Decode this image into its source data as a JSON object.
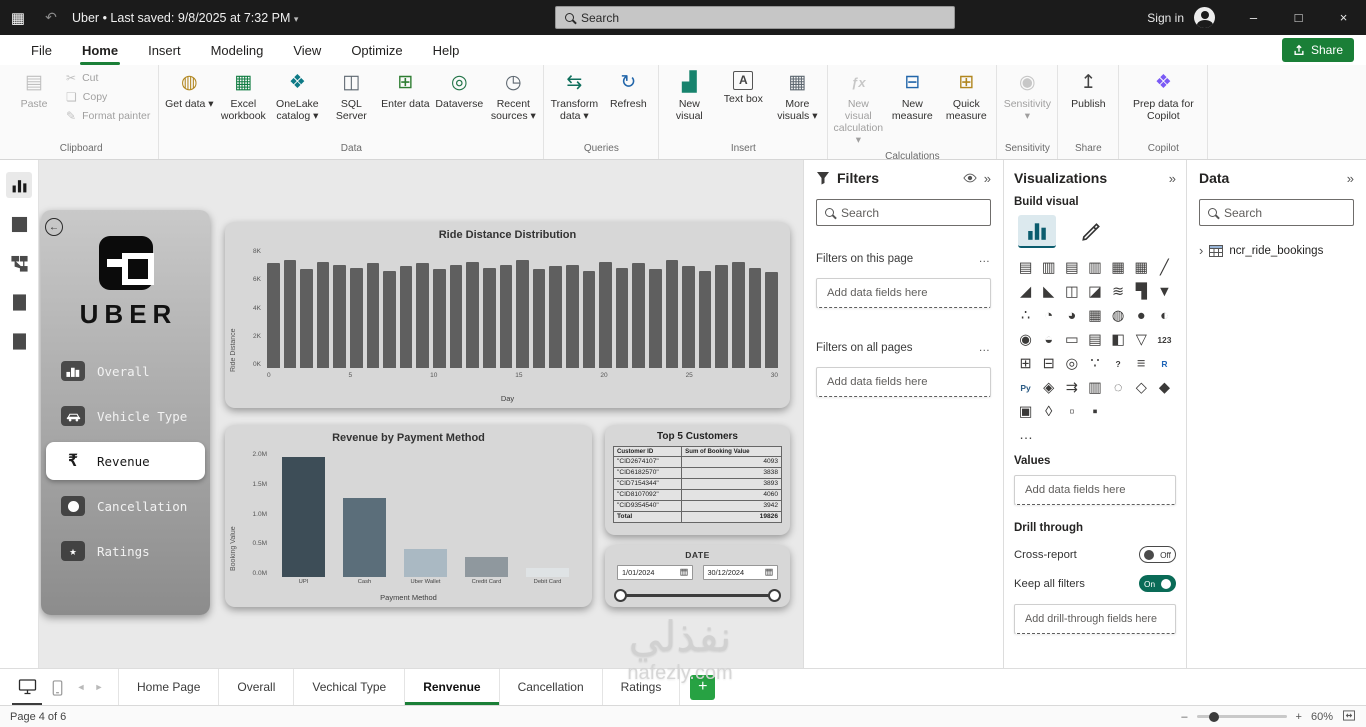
{
  "titlebar": {
    "app_icon_glyph": "▦",
    "undo_glyph": "↶",
    "title": "Uber • Last saved: 9/8/2025 at 7:32 PM",
    "title_caret": "▾",
    "search_placeholder": "Search",
    "sign_in": "Sign in",
    "minimize_glyph": "–",
    "maximize_glyph": "□",
    "close_glyph": "×"
  },
  "menu": {
    "items": [
      "File",
      "Home",
      "Insert",
      "Modeling",
      "View",
      "Optimize",
      "Help"
    ],
    "active_index": 1,
    "share_label": "Share"
  },
  "ribbon": {
    "caret": "▾",
    "groups": [
      {
        "label": "Clipboard",
        "items": [
          {
            "label": "Paste",
            "glyph": "▤",
            "color": "#7a7a7a",
            "disabled": true
          },
          {
            "label": "Cut",
            "glyph": "✂",
            "color": "#7a7a7a",
            "disabled": true,
            "small": true
          },
          {
            "label": "Copy",
            "glyph": "❏",
            "color": "#7a7a7a",
            "disabled": true,
            "small": true
          },
          {
            "label": "Format painter",
            "glyph": "✎",
            "color": "#7a7a7a",
            "disabled": true,
            "small": true
          }
        ]
      },
      {
        "label": "Data",
        "items": [
          {
            "label": "Get data",
            "glyph": "◍",
            "color": "#b1861f",
            "dropdown": true
          },
          {
            "label": "Excel workbook",
            "glyph": "▦",
            "color": "#107c41"
          },
          {
            "label": "OneLake catalog",
            "glyph": "❖",
            "color": "#0e7a86",
            "dropdown": true
          },
          {
            "label": "SQL Server",
            "glyph": "◫",
            "color": "#5d6770"
          },
          {
            "label": "Enter data",
            "glyph": "⊞",
            "color": "#2e7d32"
          },
          {
            "label": "Dataverse",
            "glyph": "◎",
            "color": "#217346"
          },
          {
            "label": "Recent sources",
            "glyph": "◷",
            "color": "#5d6770",
            "dropdown": true
          }
        ]
      },
      {
        "label": "Queries",
        "items": [
          {
            "label": "Transform data",
            "glyph": "⇆",
            "color": "#0f6f5c",
            "dropdown": true
          },
          {
            "label": "Refresh",
            "glyph": "↻",
            "color": "#2266aa"
          }
        ]
      },
      {
        "label": "Insert",
        "items": [
          {
            "label": "New visual",
            "glyph": "▟",
            "color": "#17836d"
          },
          {
            "label": "Text box",
            "glyph": "A",
            "color": "#444444",
            "boxed": true
          },
          {
            "label": "More visuals",
            "glyph": "▦",
            "color": "#5d6770",
            "dropdown": true
          }
        ]
      },
      {
        "label": "Calculations",
        "items": [
          {
            "label": "New visual calculation",
            "glyph": "ƒx",
            "color": "#8a8a8a",
            "disabled": true,
            "text_icon": true,
            "dropdown": true
          },
          {
            "label": "New measure",
            "glyph": "⊟",
            "color": "#2266aa"
          },
          {
            "label": "Quick measure",
            "glyph": "⊞",
            "color": "#b1861f"
          }
        ]
      },
      {
        "label": "Sensitivity",
        "items": [
          {
            "label": "Sensitivity",
            "glyph": "◉",
            "color": "#8a8a8a",
            "disabled": true,
            "dropdown": true
          }
        ]
      },
      {
        "label": "Share",
        "items": [
          {
            "label": "Publish",
            "glyph": "↥",
            "color": "#444444"
          }
        ]
      },
      {
        "label": "Copilot",
        "items": [
          {
            "label": "Prep data for Copilot",
            "glyph": "❖",
            "color": "#7a5af5",
            "wide": true
          }
        ]
      }
    ]
  },
  "view_rail": {
    "items": [
      {
        "name": "report-view",
        "active": true
      },
      {
        "name": "table-view"
      },
      {
        "name": "model-view"
      },
      {
        "name": "dax-query-view"
      },
      {
        "name": "tmdl-view"
      }
    ]
  },
  "dashboard": {
    "back_glyph": "←",
    "sidebar": {
      "brand": "UBER",
      "nav": [
        {
          "label": "Overall",
          "icon": "bar-chart-icon"
        },
        {
          "label": "Vehicle Type",
          "icon": "car-icon"
        },
        {
          "label": "Revenue",
          "icon": "rupee-icon",
          "active": true
        },
        {
          "label": "Cancellation",
          "icon": "cancel-icon"
        },
        {
          "label": "Ratings",
          "icon": "star-icon"
        }
      ]
    }
  },
  "chart_data": [
    {
      "type": "bar",
      "title": "Ride Distance Distribution",
      "xlabel": "Day",
      "ylabel": "Ride Distance",
      "x": [
        0,
        1,
        2,
        3,
        4,
        5,
        6,
        7,
        8,
        9,
        10,
        11,
        12,
        13,
        14,
        15,
        16,
        17,
        18,
        19,
        20,
        21,
        22,
        23,
        24,
        25,
        26,
        27,
        28,
        29,
        30
      ],
      "values": [
        7000,
        7200,
        6600,
        7100,
        6900,
        6700,
        7000,
        6500,
        6800,
        7000,
        6600,
        6900,
        7100,
        6700,
        6900,
        7200,
        6600,
        6800,
        6900,
        6500,
        7100,
        6700,
        7000,
        6600,
        7200,
        6800,
        6500,
        6900,
        7100,
        6700,
        6400
      ],
      "ylim": [
        0,
        8000
      ],
      "ytick_labels": [
        "0K",
        "2K",
        "4K",
        "6K",
        "8K"
      ],
      "xtick_labels": [
        "0",
        "5",
        "10",
        "15",
        "20",
        "25",
        "30"
      ],
      "bar_color": "#5f5f5f"
    },
    {
      "type": "bar",
      "title": "Revenue by Payment Method",
      "xlabel": "Payment Method",
      "ylabel": "Booking Value",
      "categories": [
        "UPI",
        "Cash",
        "Uber Wallet",
        "Credit Card",
        "Debit Card"
      ],
      "values": [
        1900000,
        1250000,
        450000,
        320000,
        150000
      ],
      "ylim": [
        0,
        2000000
      ],
      "ytick_labels": [
        "0.0M",
        "0.5M",
        "1.0M",
        "1.5M",
        "2.0M"
      ],
      "bar_colors": [
        "#3d4d57",
        "#5b6e7a",
        "#aab9c3",
        "#8f989e",
        "#dfe3e5"
      ]
    },
    {
      "type": "table",
      "title": "Top 5 Customers",
      "columns": [
        "Customer ID",
        "Sum of Booking Value"
      ],
      "rows": [
        [
          "\"CID2674107\"",
          "4093"
        ],
        [
          "\"CID6182570\"",
          "3838"
        ],
        [
          "\"CID7154344\"",
          "3893"
        ],
        [
          "\"CID8107092\"",
          "4060"
        ],
        [
          "\"CID9354540\"",
          "3942"
        ]
      ],
      "total": [
        "Total",
        "19826"
      ]
    },
    {
      "type": "slicer",
      "title": "DATE",
      "start_date": "1/01/2024",
      "end_date": "30/12/2024"
    }
  ],
  "filters_pane": {
    "title": "Filters",
    "collapse_glyph": "»",
    "search_placeholder": "Search",
    "more_glyph": "…",
    "sections": [
      {
        "label": "Filters on this page",
        "placeholder": "Add data fields here"
      },
      {
        "label": "Filters on all pages",
        "placeholder": "Add data fields here"
      }
    ]
  },
  "viz_pane": {
    "title": "Visualizations",
    "collapse_glyph": "»",
    "build_visual": "Build visual",
    "more_glyph": "…",
    "values_label": "Values",
    "values_placeholder": "Add data fields here",
    "drill_label": "Drill through",
    "cross_report": "Cross-report",
    "cross_state": "Off",
    "keep_filters": "Keep all filters",
    "keep_state": "On",
    "drill_placeholder": "Add drill-through fields here",
    "visual_icons": [
      {
        "name": "stacked-bar-chart",
        "glyph": "▤"
      },
      {
        "name": "stacked-column-chart",
        "glyph": "▥"
      },
      {
        "name": "clustered-bar-chart",
        "glyph": "▤"
      },
      {
        "name": "clustered-column-chart",
        "glyph": "▥"
      },
      {
        "name": "100-stacked-bar-chart",
        "glyph": "▦"
      },
      {
        "name": "100-stacked-column-chart",
        "glyph": "▦"
      },
      {
        "name": "line-chart",
        "glyph": "╱"
      },
      {
        "name": "area-chart",
        "glyph": "◢"
      },
      {
        "name": "stacked-area-chart",
        "glyph": "◣"
      },
      {
        "name": "line-and-stacked-column-chart",
        "glyph": "◫"
      },
      {
        "name": "line-and-clustered-column-chart",
        "glyph": "◪"
      },
      {
        "name": "ribbon-chart",
        "glyph": "≋"
      },
      {
        "name": "waterfall-chart",
        "glyph": "▜"
      },
      {
        "name": "funnel-chart",
        "glyph": "▼"
      },
      {
        "name": "scatter-chart",
        "glyph": "∴"
      },
      {
        "name": "pie-chart",
        "glyph": "◔"
      },
      {
        "name": "donut-chart",
        "glyph": "◕"
      },
      {
        "name": "treemap",
        "glyph": "▦"
      },
      {
        "name": "map",
        "glyph": "◍"
      },
      {
        "name": "filled-map",
        "glyph": "●"
      },
      {
        "name": "shape-map",
        "glyph": "◐"
      },
      {
        "name": "azure-map",
        "glyph": "◉"
      },
      {
        "name": "gauge",
        "glyph": "◒"
      },
      {
        "name": "card",
        "glyph": "▭"
      },
      {
        "name": "multi-row-card",
        "glyph": "▤"
      },
      {
        "name": "kpi",
        "glyph": "◧"
      },
      {
        "name": "slicer",
        "glyph": "▽"
      },
      {
        "name": "numeric-range-slicer",
        "glyph": "123",
        "text": true
      },
      {
        "name": "table",
        "glyph": "⊞"
      },
      {
        "name": "matrix",
        "glyph": "⊟"
      },
      {
        "name": "key-influencers",
        "glyph": "◎"
      },
      {
        "name": "decomposition-tree",
        "glyph": "∵"
      },
      {
        "name": "qa-visual",
        "glyph": "?",
        "text": true
      },
      {
        "name": "smart-narrative",
        "glyph": "≡"
      },
      {
        "name": "r-script-visual",
        "glyph": "R",
        "text": true,
        "color": "#1f65b7"
      },
      {
        "name": "python-visual",
        "glyph": "Py",
        "text": true,
        "color": "#2b5b84"
      },
      {
        "name": "power-apps",
        "glyph": "◈"
      },
      {
        "name": "power-automate",
        "glyph": "⇉"
      },
      {
        "name": "paginated-report",
        "glyph": "▥"
      },
      {
        "name": "arcgis-map",
        "glyph": "◌"
      },
      {
        "name": "metrics",
        "glyph": "◇"
      },
      {
        "name": "scorecard",
        "glyph": "◆"
      },
      {
        "name": "custom-visual-1",
        "glyph": "▣"
      },
      {
        "name": "custom-visual-2",
        "glyph": "◊"
      },
      {
        "name": "custom-visual-3",
        "glyph": "▫"
      },
      {
        "name": "custom-visual-4",
        "glyph": "▪"
      }
    ]
  },
  "data_pane": {
    "title": "Data",
    "collapse_glyph": "»",
    "search_placeholder": "Search",
    "expand_glyph": "›",
    "tables": [
      {
        "name": "ncr_ride_bookings"
      }
    ]
  },
  "page_tabs": {
    "prev_glyph": "◄",
    "next_glyph": "►",
    "tabs": [
      "Home Page",
      "Overall",
      "Vechical Type",
      "Renvenue",
      "Cancellation",
      "Ratings"
    ],
    "active_index": 3,
    "add_label": "+"
  },
  "status_bar": {
    "page_indicator": "Page 4 of 6",
    "zoom_out": "–",
    "zoom_in": "+",
    "zoom": "60%"
  },
  "watermark": {
    "line1": "نفذلي",
    "line2": "nafezly.com"
  }
}
